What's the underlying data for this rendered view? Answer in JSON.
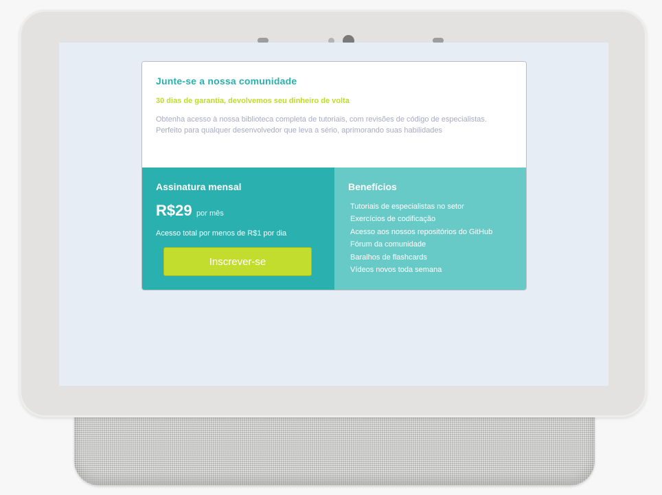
{
  "card": {
    "title": "Junte-se a nossa comunidade",
    "guarantee": "30 dias de garantia, devolvemos seu dinheiro de volta",
    "description": "Obtenha acesso à nossa biblioteca completa de tutoriais, com revisões de código de especialistas. Perfeito para qualquer desenvolvedor que leva a sério, aprimorando suas habilidades"
  },
  "subscription": {
    "heading": "Assinatura mensal",
    "price": "R$29",
    "price_unit": "por mês",
    "note": "Acesso total por menos de R$1 por dia",
    "button_label": "Inscrever-se"
  },
  "benefits": {
    "heading": "Benefícios",
    "items": [
      "Tutoriais de especialistas no setor",
      "Exercícios de codificação",
      "Acesso aos nossos repositórios do GitHub",
      "Fórum da comunidade",
      "Baralhos de flashcards",
      "Vídeos novos toda semana"
    ]
  },
  "colors": {
    "teal": "#2ab0ae",
    "light_teal": "#68cac7",
    "lime": "#bfda2c",
    "muted_text": "#a9a9c4"
  }
}
